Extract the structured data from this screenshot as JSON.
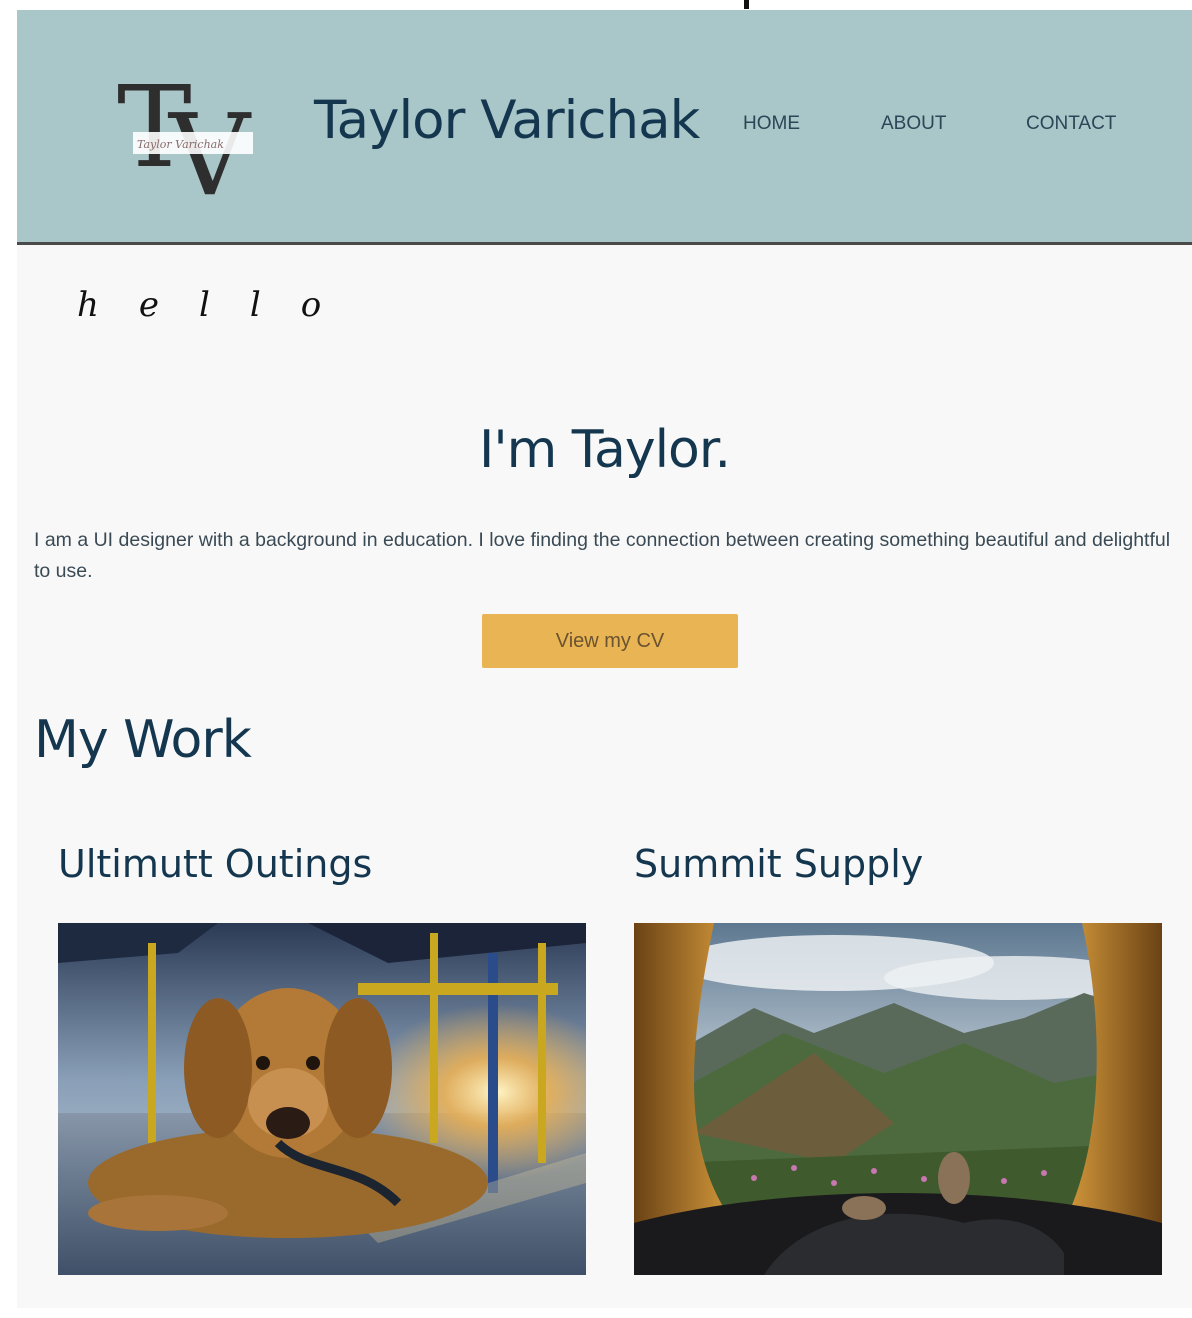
{
  "header": {
    "site_title": "Taylor Varichak",
    "logo": {
      "monogram": "TV",
      "signature": "Taylor Varichak"
    },
    "nav": [
      {
        "label": "HOME"
      },
      {
        "label": "ABOUT"
      },
      {
        "label": "CONTACT"
      }
    ]
  },
  "hero": {
    "greeting": "hello",
    "heading": "I'm Taylor.",
    "intro": "I am a UI designer with a background in education. I love finding the connection between creating something beautiful and delightful to use.",
    "cta_label": "View my CV"
  },
  "work": {
    "heading": "My Work",
    "projects": [
      {
        "title": "Ultimutt Outings",
        "image": "golden-retriever-puppy-photo"
      },
      {
        "title": "Summit Supply",
        "image": "mountain-view-from-tent-photo"
      }
    ]
  },
  "colors": {
    "header_bg": "#a9c6c8",
    "title_navy": "#14374f",
    "button_gold": "#e9b453",
    "page_bg": "#f8f8f8"
  }
}
